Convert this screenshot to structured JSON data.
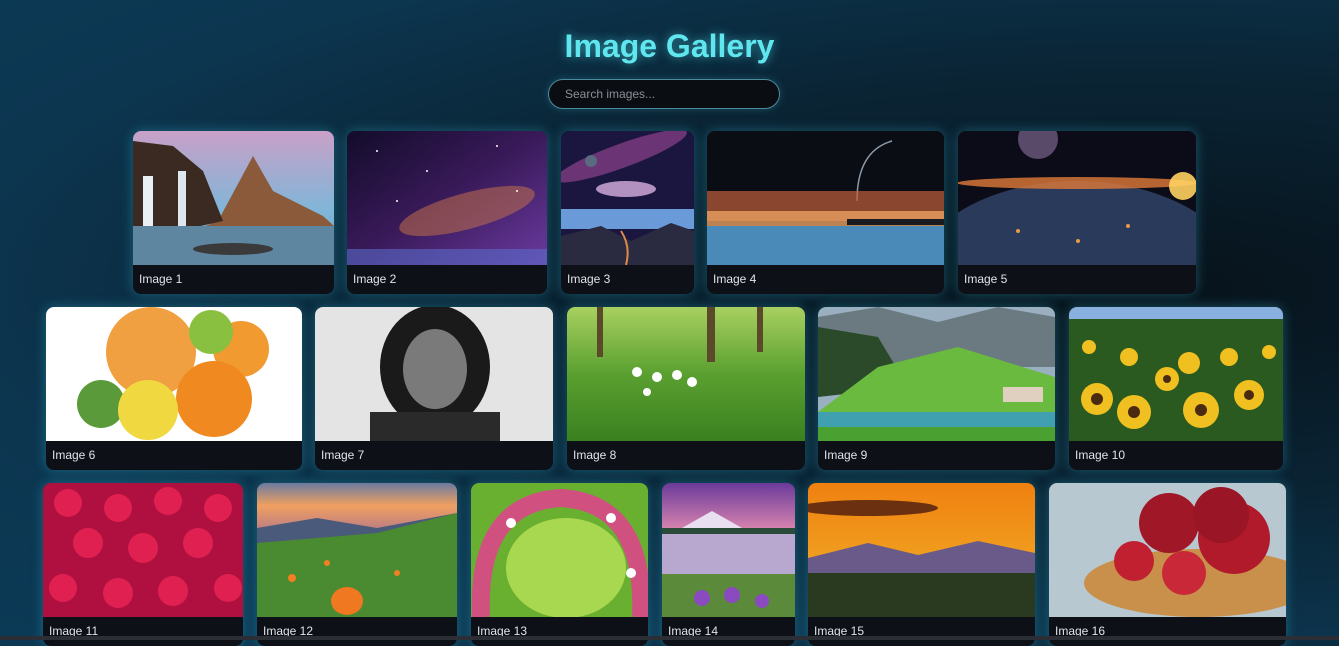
{
  "header": {
    "title": "Image Gallery"
  },
  "search": {
    "placeholder": "Search images..."
  },
  "gallery": {
    "images": [
      {
        "label": "Image 1"
      },
      {
        "label": "Image 2"
      },
      {
        "label": "Image 3"
      },
      {
        "label": "Image 4"
      },
      {
        "label": "Image 5"
      },
      {
        "label": "Image 6"
      },
      {
        "label": "Image 7"
      },
      {
        "label": "Image 8"
      },
      {
        "label": "Image 9"
      },
      {
        "label": "Image 10"
      },
      {
        "label": "Image 11"
      },
      {
        "label": "Image 12"
      },
      {
        "label": "Image 13"
      },
      {
        "label": "Image 14"
      },
      {
        "label": "Image 15"
      },
      {
        "label": "Image 16"
      }
    ]
  },
  "colors": {
    "accent": "#5fe6ee",
    "card_bg": "#0d1117"
  }
}
